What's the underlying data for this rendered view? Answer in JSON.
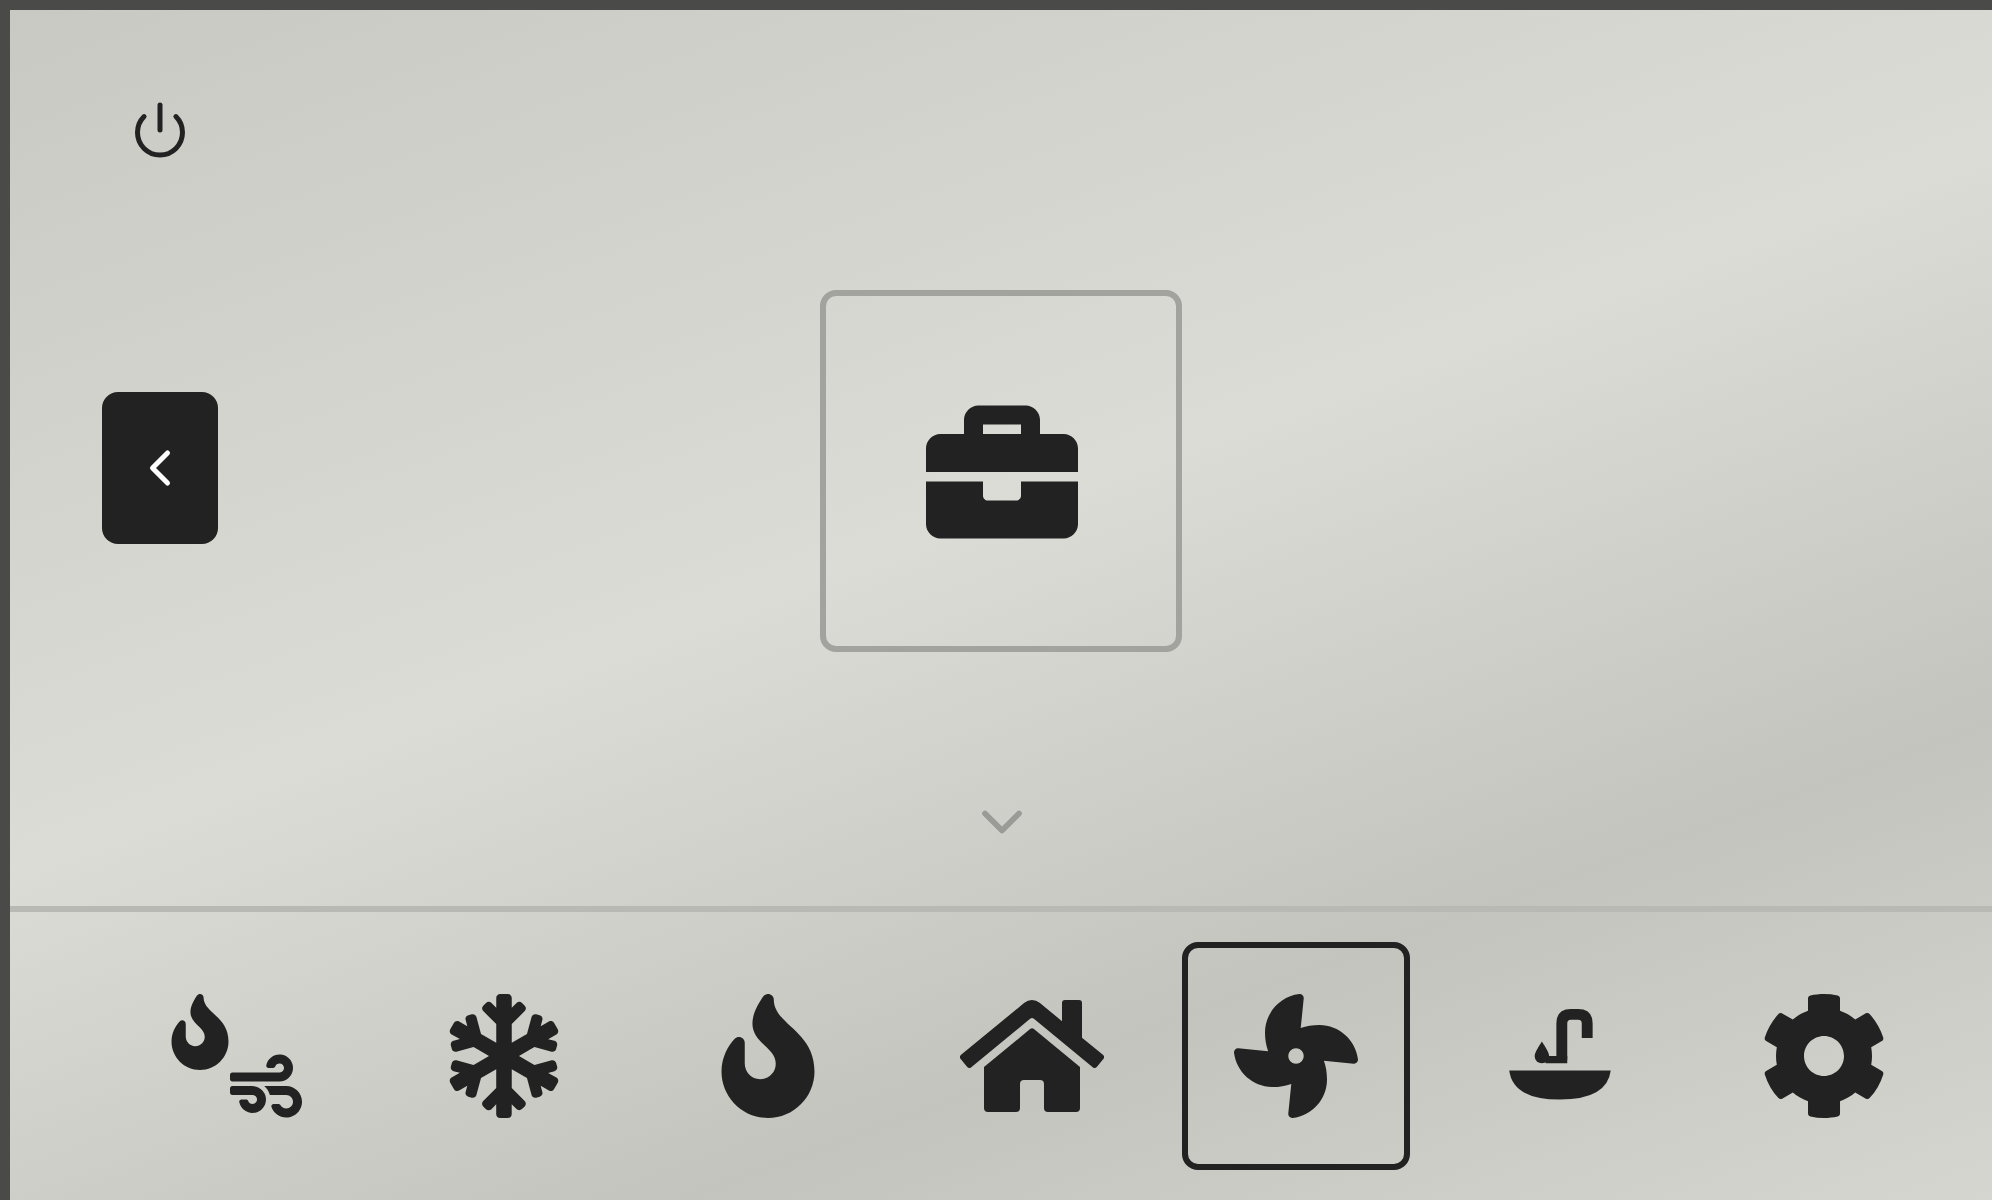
{
  "mode": {
    "kind": "away"
  },
  "nav": [
    {
      "kind": "heat-fan",
      "selected": false
    },
    {
      "kind": "cool",
      "selected": false
    },
    {
      "kind": "heat",
      "selected": false
    },
    {
      "kind": "home",
      "selected": false
    },
    {
      "kind": "fan",
      "selected": true
    },
    {
      "kind": "water",
      "selected": false
    },
    {
      "kind": "settings",
      "selected": false
    }
  ]
}
